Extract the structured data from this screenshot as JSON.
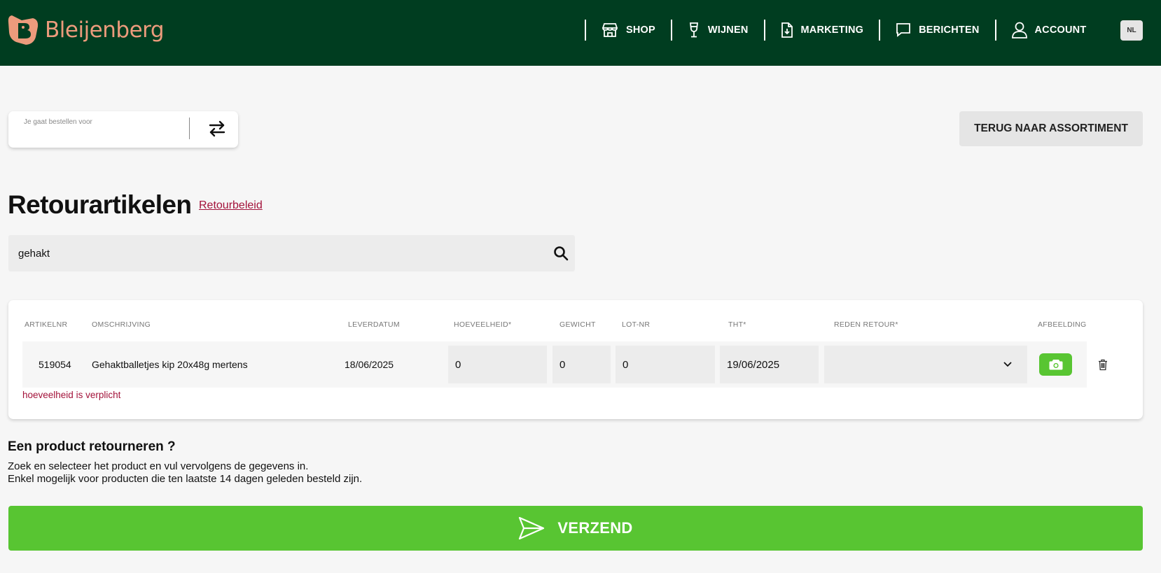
{
  "header": {
    "brand": "Bleijenberg",
    "nav": [
      {
        "label": "SHOP",
        "icon": "shop-icon"
      },
      {
        "label": "WIJNEN",
        "icon": "wine-glass-icon"
      },
      {
        "label": "MARKETING",
        "icon": "document-download-icon"
      },
      {
        "label": "BERICHTEN",
        "icon": "chat-icon"
      },
      {
        "label": "ACCOUNT",
        "icon": "user-icon"
      }
    ],
    "language": "NL"
  },
  "customer": {
    "label": "Je gaat bestellen voor",
    "value": ""
  },
  "back_button": "TERUG NAAR ASSORTIMENT",
  "page": {
    "title": "Retourartikelen",
    "policy_link": "Retourbeleid"
  },
  "search": {
    "value": "gehakt"
  },
  "table": {
    "headers": {
      "artikelnr": "ARTIKELNR",
      "omschrijving": "OMSCHRIJVING",
      "leverdatum": "LEVERDATUM",
      "hoeveelheid": "HOEVEELHEID*",
      "gewicht": "GEWICHT",
      "lotnr": "LOT-NR",
      "tht": "THT*",
      "reden": "REDEN RETOUR*",
      "afbeelding": "AFBEELDING"
    },
    "rows": [
      {
        "artikelnr": "519054",
        "omschrijving": "Gehaktballetjes kip 20x48g mertens",
        "leverdatum": "18/06/2025",
        "hoeveelheid": "0",
        "gewicht": "0",
        "lotnr": "0",
        "tht": "19/06/2025",
        "reden": "",
        "error": "hoeveelheid is verplicht"
      }
    ]
  },
  "info": {
    "title": "Een product retourneren ?",
    "line1": "Zoek en selecteer het product en vul vervolgens de gegevens in.",
    "line2": "Enkel mogelijk voor producten die ten laatste 14 dagen geleden besteld zijn."
  },
  "submit_label": "VERZEND",
  "colors": {
    "header_bg": "#003d20",
    "brand": "#ec9b7c",
    "accent_green": "#58c532",
    "error": "#a3123a"
  }
}
